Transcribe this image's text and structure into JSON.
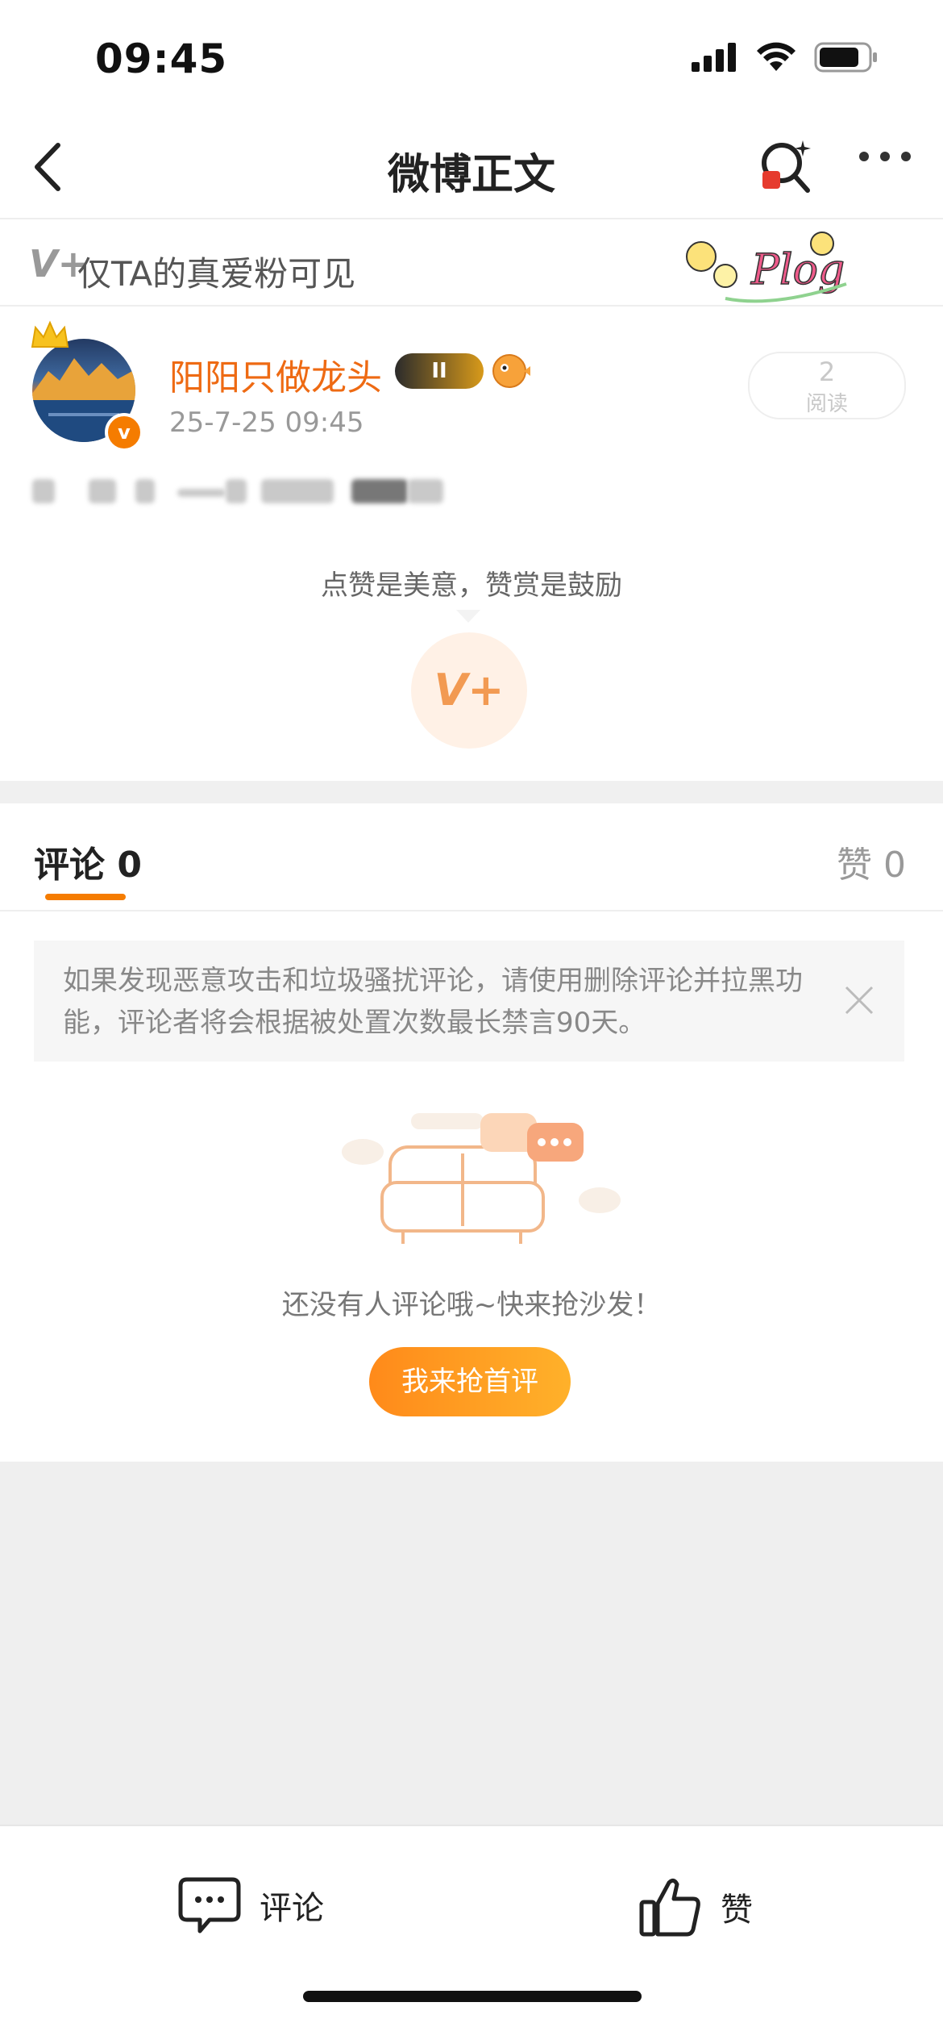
{
  "status_bar": {
    "time": "09:45"
  },
  "nav": {
    "title": "微博正文"
  },
  "banner": {
    "icon_text": "V+",
    "text": "仅TA的真爱粉可见"
  },
  "user": {
    "name": "阳阳只做龙头",
    "badge_level": "II",
    "post_time": "25-7-25 09:45"
  },
  "read": {
    "count": "2",
    "label": "阅读"
  },
  "reward": {
    "text": "点赞是美意，赞赏是鼓励",
    "icon_text": "V+"
  },
  "tabs": {
    "comments": "评论 0",
    "likes": "赞 0"
  },
  "notice": {
    "text": "如果发现恶意攻击和垃圾骚扰评论，请使用删除评论并拉黑功能，评论者将会根据被处置次数最长禁言90天。"
  },
  "empty": {
    "text": "还没有人评论哦~快来抢沙发！",
    "button": "我来抢首评"
  },
  "bottom_bar": {
    "comment_label": "评论",
    "like_label": "赞"
  },
  "colors": {
    "accent": "#f57c00",
    "username": "#ee6a13"
  }
}
